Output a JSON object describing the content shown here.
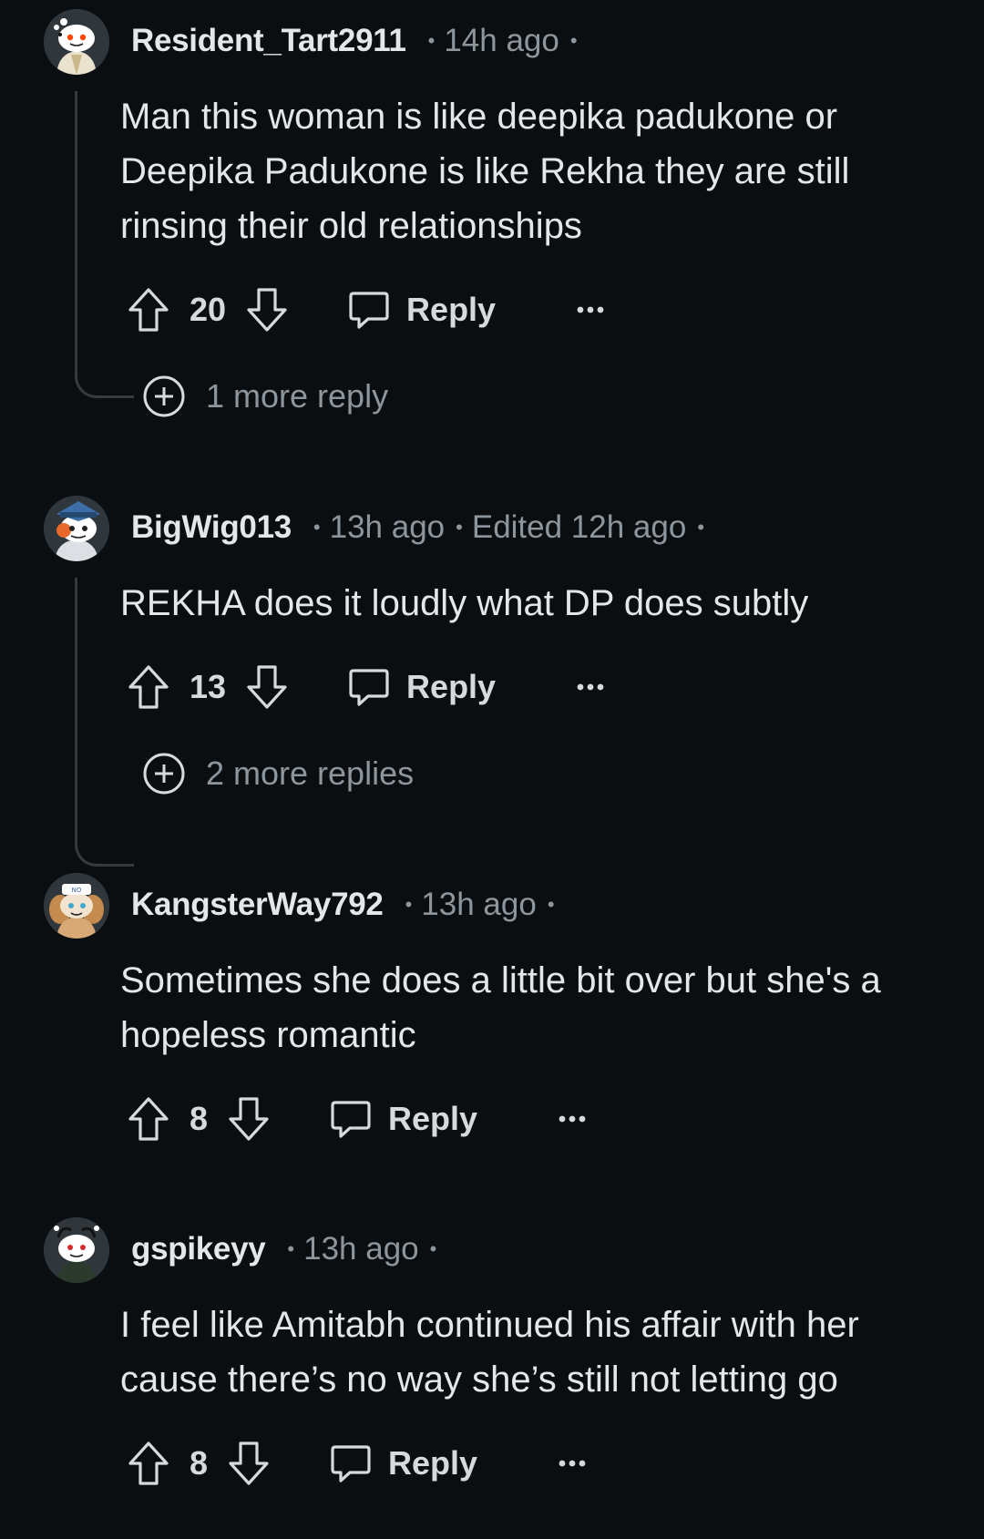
{
  "comments": [
    {
      "username": "Resident_Tart2911",
      "time": "14h ago",
      "edited": "",
      "text": "Man this woman is like deepika padukone or Deepika Padukone is like Rekha they are still rinsing their old relationships",
      "votes": "20",
      "reply_label": "Reply",
      "more_replies": "1 more reply"
    },
    {
      "username": "BigWig013",
      "time": "13h ago",
      "edited": "Edited 12h ago",
      "text": "REKHA does it loudly what DP does subtly",
      "votes": "13",
      "reply_label": "Reply",
      "more_replies": "2 more replies"
    },
    {
      "username": "KangsterWay792",
      "time": "13h ago",
      "edited": "",
      "text": "Sometimes she does a little bit over but she's a hopeless romantic",
      "votes": "8",
      "reply_label": "Reply",
      "more_replies": ""
    },
    {
      "username": "gspikeyy",
      "time": "13h ago",
      "edited": "",
      "text": "I feel like Amitabh continued his affair with her cause there’s no way she’s still not letting go",
      "votes": "8",
      "reply_label": "Reply",
      "more_replies": ""
    }
  ],
  "icons": {
    "upvote": "arrow-up-outline-icon",
    "downvote": "arrow-down-outline-icon",
    "reply": "speech-bubble-icon",
    "more": "ellipsis-icon",
    "expand": "plus-circle-icon"
  },
  "colors": {
    "background": "#0b0e11",
    "text": "#e4e6e8",
    "muted": "#8d969c",
    "thread_line": "#343a3f"
  }
}
